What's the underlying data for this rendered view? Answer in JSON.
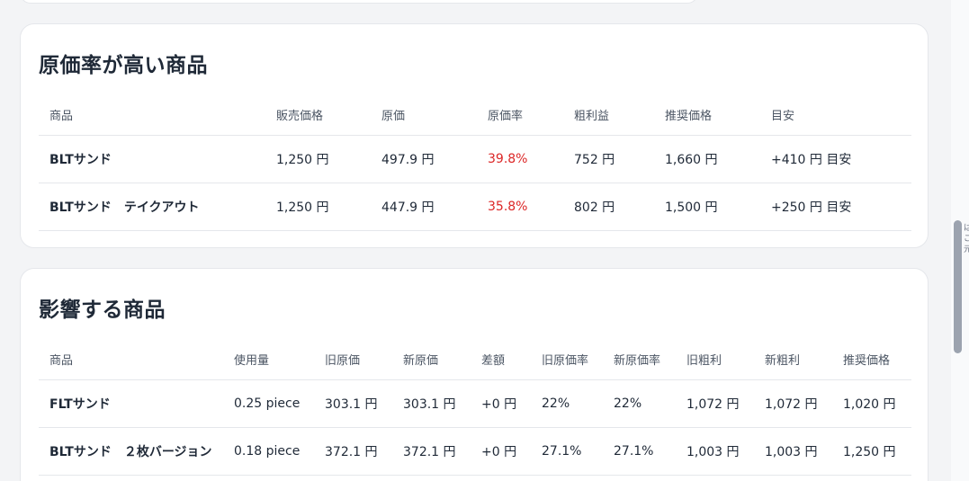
{
  "section_high_cost": {
    "title": "原価率が高い商品",
    "headers": [
      "商品",
      "販売価格",
      "原価",
      "原価率",
      "粗利益",
      "推奨価格",
      "目安"
    ],
    "rows": [
      [
        "BLTサンド",
        "1,250 円",
        "497.9 円",
        "39.8%",
        "752 円",
        "1,660 円",
        "+410 円 目安"
      ],
      [
        "BLTサンド　テイクアウト",
        "1,250 円",
        "447.9 円",
        "35.8%",
        "802 円",
        "1,500 円",
        "+250 円 目安"
      ]
    ],
    "rate_color": "#dc2626"
  },
  "section_affected": {
    "title": "影響する商品",
    "headers": [
      "商品",
      "使用量",
      "旧原価",
      "新原価",
      "差額",
      "旧原価率",
      "新原価率",
      "旧粗利",
      "新粗利",
      "推奨価格"
    ],
    "rows": [
      [
        "FLTサンド",
        "0.25 piece",
        "303.1 円",
        "303.1 円",
        "+0 円",
        "22%",
        "22%",
        "1,072 円",
        "1,072 円",
        "1,020 円"
      ],
      [
        "BLTサンド　２枚バージョン",
        "0.18 piece",
        "372.1 円",
        "372.1 円",
        "+0 円",
        "27.1%",
        "27.1%",
        "1,003 円",
        "1,003 円",
        "1,250 円"
      ]
    ]
  },
  "edge_text": [
    "は",
    "こ",
    "元"
  ]
}
